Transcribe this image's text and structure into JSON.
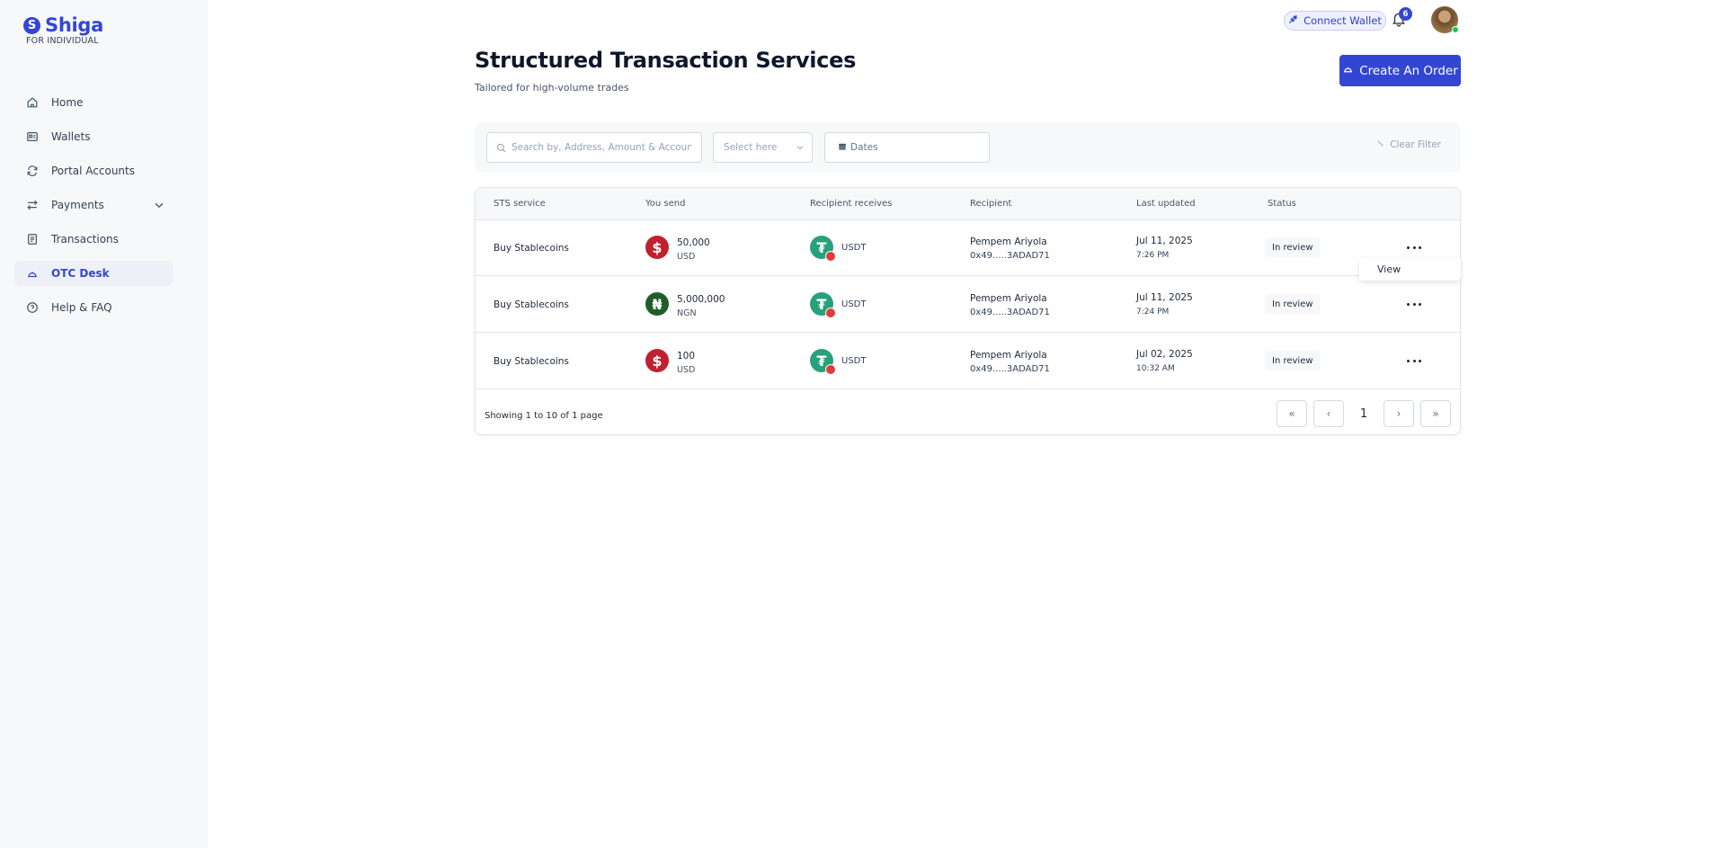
{
  "brand": {
    "name": "Shiga",
    "subtitle": "FOR INDIVIDUAL",
    "mark": "S"
  },
  "sidebar": {
    "items": [
      {
        "label": "Home",
        "icon": "home-icon"
      },
      {
        "label": "Wallets",
        "icon": "wallet-icon"
      },
      {
        "label": "Portal Accounts",
        "icon": "refresh-icon"
      },
      {
        "label": "Payments",
        "icon": "transfer-icon"
      },
      {
        "label": "Transactions",
        "icon": "receipt-icon"
      },
      {
        "label": "OTC Desk",
        "icon": "bell-desk-icon",
        "active": true
      },
      {
        "label": "Help & FAQ",
        "icon": "help-circle-icon"
      }
    ]
  },
  "topbar": {
    "connect_label": "Connect Wallet",
    "notification_count": "6"
  },
  "header": {
    "title": "Structured Transaction Services",
    "subtitle": "Tailored for high-volume trades",
    "create_label": "Create An Order"
  },
  "filters": {
    "search_placeholder": "Search by, Address, Amount & Account",
    "select_placeholder": "Select here",
    "dates_label": "Dates",
    "clear_label": "Clear Filter"
  },
  "table": {
    "columns": [
      "STS service",
      "You send",
      "Recipient receives",
      "Recipient",
      "Last updated",
      "Status"
    ],
    "rows": [
      {
        "service": "Buy Stablecoins",
        "send_amount": "50,000",
        "send_currency": "USD",
        "send_symbol": "$",
        "send_color": "#c0212f",
        "receive_currency": "USDT",
        "recipient_name": "Pempem Ariyola",
        "recipient_address": "0x49.....3ADAD71",
        "date": "Jul 11, 2025",
        "time": "7:26 PM",
        "status": "In review"
      },
      {
        "service": "Buy Stablecoins",
        "send_amount": "5,000,000",
        "send_currency": "NGN",
        "send_symbol": "₦",
        "send_color": "#1f5e2a",
        "receive_currency": "USDT",
        "recipient_name": "Pempem Ariyola",
        "recipient_address": "0x49.....3ADAD71",
        "date": "Jul 11, 2025",
        "time": "7:24 PM",
        "status": "In review"
      },
      {
        "service": "Buy Stablecoins",
        "send_amount": "100",
        "send_currency": "USD",
        "send_symbol": "$",
        "send_color": "#c0212f",
        "receive_currency": "USDT",
        "recipient_name": "Pempem Ariyola",
        "recipient_address": "0x49.....3ADAD71",
        "date": "Jul 02, 2025",
        "time": "10:32 AM",
        "status": "In review"
      }
    ],
    "row_menu_label": "View",
    "showing_text": "Showing 1 to 10 of 1 page",
    "pagination": {
      "first": "«",
      "prev": "‹",
      "current": "1",
      "next": "›",
      "last": "»"
    }
  },
  "colors": {
    "accent": "#3346d3",
    "usdt": "#26a17b"
  }
}
